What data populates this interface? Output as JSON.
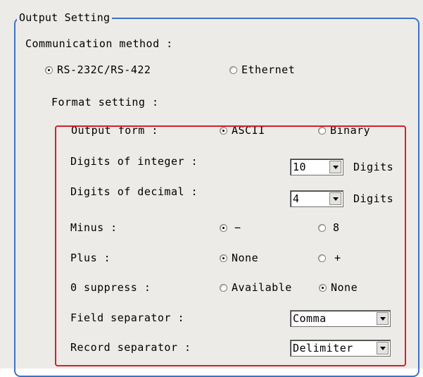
{
  "group": {
    "title": "Output Setting"
  },
  "communication": {
    "label": "Communication method :",
    "options": [
      {
        "label": "RS-232C/RS-422",
        "selected": true
      },
      {
        "label": "Ethernet",
        "selected": false
      }
    ]
  },
  "format": {
    "label": "Format setting :",
    "output_form": {
      "label": "Output form :",
      "options": [
        {
          "label": "ASCII",
          "selected": true
        },
        {
          "label": "Binary",
          "selected": false
        }
      ]
    },
    "digits_integer": {
      "label": "Digits of integer :",
      "value": "10",
      "unit": "Digits"
    },
    "digits_decimal": {
      "label": "Digits of decimal :",
      "value": "4",
      "unit": "Digits"
    },
    "minus": {
      "label": "Minus :",
      "options": [
        {
          "label": "−",
          "selected": true
        },
        {
          "label": "8",
          "selected": false
        }
      ]
    },
    "plus": {
      "label": "Plus :",
      "options": [
        {
          "label": "None",
          "selected": true
        },
        {
          "label": "+",
          "selected": false
        }
      ]
    },
    "zero_suppress": {
      "label": "0 suppress :",
      "options": [
        {
          "label": "Available",
          "selected": false
        },
        {
          "label": "None",
          "selected": true
        }
      ]
    },
    "field_separator": {
      "label": "Field separator :",
      "value": "Comma"
    },
    "record_separator": {
      "label": "Record separator :",
      "value": "Delimiter"
    }
  },
  "colors": {
    "group_border": "#3d72c4",
    "highlight_box": "#d6202a",
    "panel_bg": "#ecebe8"
  }
}
